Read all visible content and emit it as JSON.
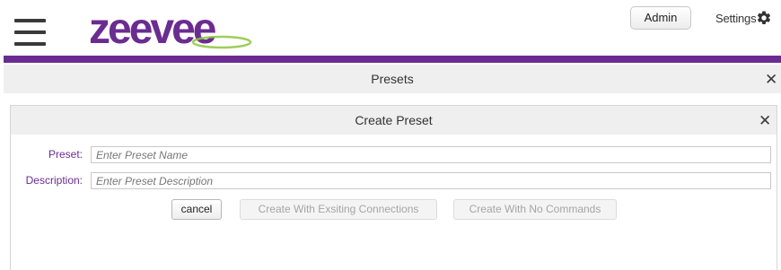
{
  "header": {
    "logo_text": "zeevee",
    "admin_label": "Admin",
    "settings_label": "Settings",
    "brand_purple": "#6b2c91",
    "logo_green": "#8dc63f",
    "icons": [
      "hamburger-menu-icon",
      "gear-icon"
    ]
  },
  "presets_panel": {
    "title": "Presets",
    "close_glyph": "✕"
  },
  "create_dialog": {
    "title": "Create Preset",
    "close_glyph": "✕",
    "fields": {
      "preset": {
        "label": "Preset:",
        "placeholder": "Enter Preset Name",
        "value": ""
      },
      "description": {
        "label": "Description:",
        "placeholder": "Enter Preset Description",
        "value": ""
      }
    },
    "buttons": {
      "cancel": "cancel",
      "create_existing": "Create With Exsiting Connections",
      "create_none": "Create With No Commands"
    }
  }
}
